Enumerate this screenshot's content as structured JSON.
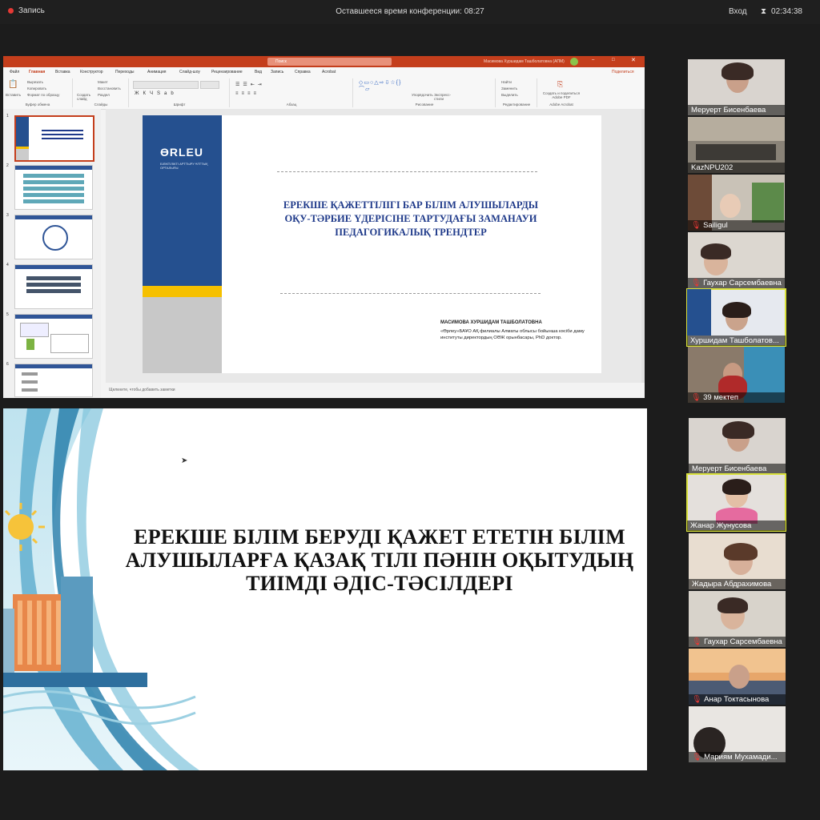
{
  "topbar": {
    "record_label": "Запись",
    "remaining_label": "Оставшееся время конференции: 08:27",
    "login_label": "Вход",
    "elapsed_time": "02:34:38"
  },
  "ppt": {
    "window_title": "Масимова Хуршидам Ташболатовна (АПМ)",
    "search_placeholder": "Поиск",
    "share_label": "Поделиться",
    "menu": [
      "Файл",
      "Главная",
      "Вставка",
      "Конструктор",
      "Переходы",
      "Анимация",
      "Слайд-шоу",
      "Рецензирование",
      "Вид",
      "Запись",
      "Справка",
      "Acrobat"
    ],
    "ribbon_groups": [
      "Буфер обмена",
      "Слайды",
      "Шрифт",
      "Абзац",
      "Рисование",
      "Редактирование",
      "Adobe Acrobat"
    ],
    "ribbon_buttons": {
      "paste": "Вставить",
      "cut": "Вырезать",
      "copy": "Копировать",
      "format": "Формат по образцу",
      "new_slide": "Создать слайд",
      "layout": "Макет",
      "reset": "Восстановить",
      "section": "Раздел",
      "arrange": "Упорядочить",
      "styles": "Экспресс-стили",
      "find": "Найти",
      "replace": "Заменить",
      "select": "Выделить",
      "pdf": "Создать и поделиться Adobe PDF"
    },
    "slide_numbers": [
      "1",
      "2",
      "3",
      "4",
      "5",
      "6"
    ],
    "notes_placeholder": "Щелкните, чтобы добавить заметки",
    "slide": {
      "logo": "ƟRLEU",
      "logo_sub": "БІЛІКТІЛІКТІ АРТТЫРУ ҰЛТТЫҚ ОРТАЛЫҒЫ",
      "title": "ЕРЕКШЕ ҚАЖЕТТІЛІГІ БАР БІЛІМ АЛУШЫЛАРДЫ ОҚУ-ТӘРБИЕ ҮДЕРІСІНЕ ТАРТУДАҒЫ ЗАМАНАУИ ПЕДАГОГИКАЛЫҚ ТРЕНДТЕР",
      "author": "МАСИМОВА ХУРШИДАМ ТАШБОЛАТОВНА",
      "affiliation": "«Өрлеу»БАҰО АҚ филиалы Алматы облысы бойынша кәсіби даму институты директордың ОӘЖ орынбасары, PhD доктор."
    }
  },
  "screen2": {
    "title": "ЕРЕКШЕ БІЛІМ БЕРУДІ ҚАЖЕТ ЕТЕТІН БІЛІМ АЛУШЫЛАРҒА ҚАЗАҚ ТІЛІ ПӘНІН ОҚЫТУДЫҢ ТИІМДІ ӘДІС-ТӘСІЛДЕРІ"
  },
  "participants_top": [
    {
      "name": "Меруерт Бисенбаева",
      "muted": false,
      "active": false
    },
    {
      "name": "KazNPU202",
      "muted": false,
      "active": false
    },
    {
      "name": "Sailigul",
      "muted": true,
      "active": false
    },
    {
      "name": "Гаухар Сарсембаевна",
      "muted": true,
      "active": false
    },
    {
      "name": "Хуршидам Ташболатов...",
      "muted": false,
      "active": true
    },
    {
      "name": "39 мектеп",
      "muted": true,
      "active": false
    }
  ],
  "participants_bottom": [
    {
      "name": "Меруерт Бисенбаева",
      "muted": false,
      "active": false
    },
    {
      "name": "Жанар Жунусова",
      "muted": false,
      "active": true
    },
    {
      "name": "Жадыра Абдрахимова",
      "muted": false,
      "active": false
    },
    {
      "name": "Гаухар Сарсембаевна",
      "muted": true,
      "active": false
    },
    {
      "name": "Анар Токтасынова",
      "muted": true,
      "active": false
    },
    {
      "name": "Мариям Мухамади...",
      "muted": true,
      "active": false
    }
  ],
  "colors": {
    "ppt_accent": "#c43e1c",
    "orleu_blue": "#25508f",
    "orleu_yellow": "#f5c000",
    "active_speaker": "#d9e13b"
  }
}
